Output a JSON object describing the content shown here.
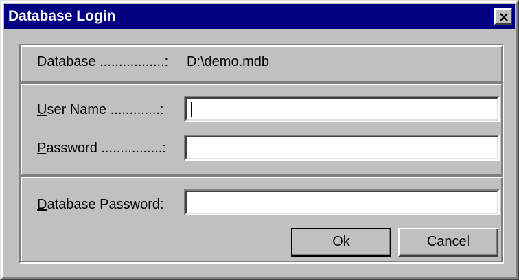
{
  "window": {
    "title": "Database Login"
  },
  "database_info": {
    "label": "Database .................:",
    "value": "D:\\demo.mdb"
  },
  "user_name": {
    "label_accel": "U",
    "label_rest": "ser Name .............:",
    "value": ""
  },
  "password": {
    "label_accel": "P",
    "label_rest": "assword ................:",
    "value": ""
  },
  "database_password": {
    "label_accel": "D",
    "label_rest": "atabase Password:",
    "value": ""
  },
  "buttons": {
    "ok": "Ok",
    "cancel": "Cancel"
  },
  "colors": {
    "titlebar": "#000080",
    "face": "#c0c0c0"
  },
  "icons": {
    "close": "close-icon"
  }
}
